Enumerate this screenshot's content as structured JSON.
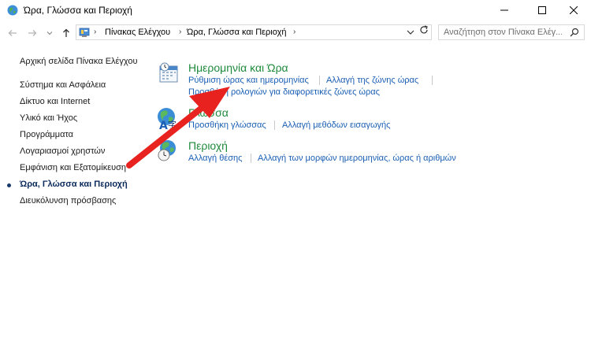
{
  "window": {
    "title": "Ώρα, Γλώσσα και Περιοχή"
  },
  "address": {
    "breadcrumbs": [
      "Πίνακας Ελέγχου",
      "Ώρα, Γλώσσα και Περιοχή"
    ]
  },
  "search": {
    "placeholder": "Αναζήτηση στον Πίνακα Ελέγ..."
  },
  "sidebar": {
    "home": "Αρχική σελίδα Πίνακα Ελέγχου",
    "items": [
      {
        "label": "Σύστημα και Ασφάλεια",
        "current": false
      },
      {
        "label": "Δίκτυο και Internet",
        "current": false
      },
      {
        "label": "Υλικό και Ήχος",
        "current": false
      },
      {
        "label": "Προγράμματα",
        "current": false
      },
      {
        "label": "Λογαριασμοί χρηστών",
        "current": false
      },
      {
        "label": "Εμφάνιση και Εξατομίκευση",
        "current": false
      },
      {
        "label": "Ώρα, Γλώσσα και Περιοχή",
        "current": true
      },
      {
        "label": "Διευκόλυνση πρόσβασης",
        "current": false
      }
    ]
  },
  "categories": [
    {
      "icon": "calendar-clock-icon",
      "title": "Ημερομηνία και Ώρα",
      "links": [
        "Ρύθμιση ώρας και ημερομηνίας",
        "Αλλαγή της ζώνης ώρας",
        "Προσθήκη ρολογιών για διαφορετικές ζώνες ώρας"
      ]
    },
    {
      "icon": "language-globe-icon",
      "title": "Γλώσσα",
      "links": [
        "Προσθήκη γλώσσας",
        "Αλλαγή μεθόδων εισαγωγής"
      ]
    },
    {
      "icon": "region-globe-clock-icon",
      "title": "Περιοχή",
      "links": [
        "Αλλαγή θέσης",
        "Αλλαγή των μορφών ημερομηνίας, ώρας ή αριθμών"
      ]
    }
  ],
  "colors": {
    "category_title": "#1e8a3c",
    "link": "#1a5fb4",
    "annotation_arrow": "#e8231f"
  }
}
